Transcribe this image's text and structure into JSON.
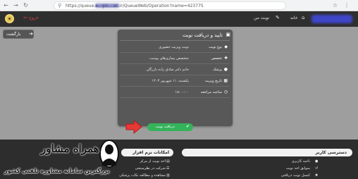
{
  "browser": {
    "url": "https://queue.e...gis....ac.ir/QueueWeb/Operation?name=423775"
  },
  "header": {
    "exit_label": "خروج",
    "nav": [
      {
        "label": "خانه",
        "icon": "home-icon"
      },
      {
        "label": "نوبت من",
        "icon": "ticket-icon"
      }
    ]
  },
  "back_button": {
    "label": "بازگشت"
  },
  "card": {
    "title": "تایید و دریافت نوبت",
    "rows": [
      {
        "key": "نوع نوبت",
        "value": "نوبت ویزیت حضوری",
        "icon": "tag-icon"
      },
      {
        "key": "تخصص",
        "value": "متخصص بیماری‌های پوست",
        "icon": "specialty-icon"
      },
      {
        "key": "پزشک",
        "value": "خانم دکتر صادق زاده بازرگان",
        "icon": "doctor-icon"
      },
      {
        "key": "تاریخ ویزیت",
        "value": "یکشنبه، ۱۱ شهریور ۱۴۰۳",
        "icon": "calendar-icon"
      },
      {
        "key": "ساعت مراجعه",
        "value": "۱۸:۰۰:۰۰",
        "icon": "clock-icon"
      }
    ],
    "receive_label": "دریافت نوبت"
  },
  "footer": {
    "access_title": "دسترسی کاربر",
    "access_items": [
      "ناحیه کاربری",
      "سوابق اخذ نوبت",
      "کنسل نوبت دریافتی"
    ],
    "software_title": "امکانات نرم افزار",
    "software_items": [
      "اخذ نوبت از مرکز",
      "شرکت در نظرسنجی",
      "مشاهده و مطالعه نکات پزشکی"
    ]
  },
  "watermark": {
    "title": "همراه مشاور",
    "subtitle": "بزرگترین سامانه مشاوره تلفنی کشور"
  },
  "colors": {
    "header": "#2f2f2f",
    "page_bg": "#9e9e9e",
    "card": "#585858",
    "accent_green": "#35b35a",
    "exit_red": "#e04545",
    "arrow_red": "#e53935"
  }
}
